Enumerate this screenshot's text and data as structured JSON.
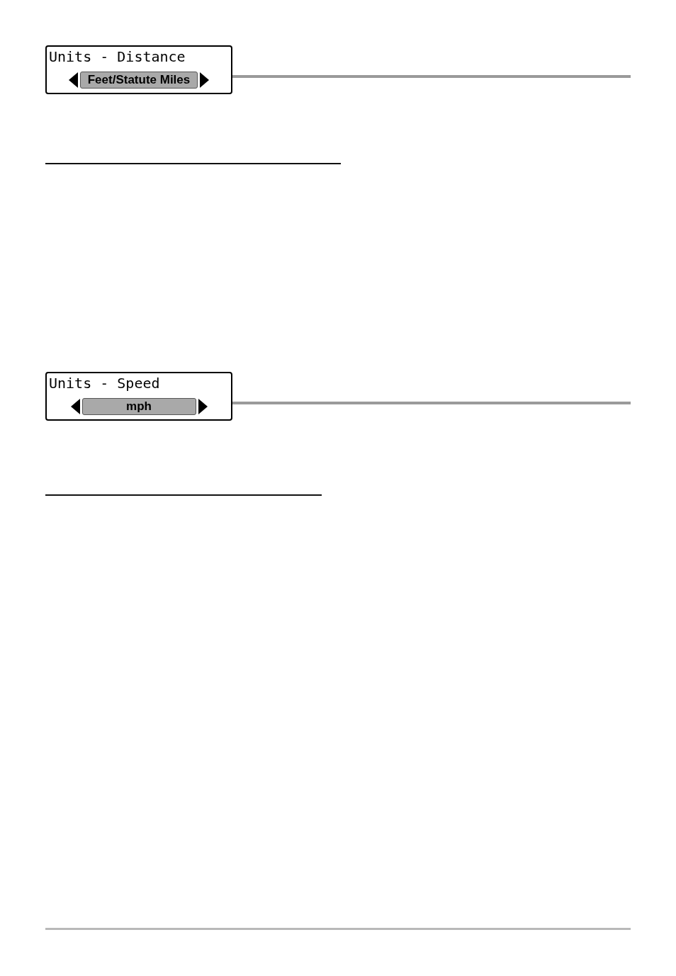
{
  "menus": [
    {
      "title": "Units - Distance",
      "value": "Feet/Statute Miles"
    },
    {
      "title": "Units - Speed",
      "value": "mph"
    }
  ]
}
